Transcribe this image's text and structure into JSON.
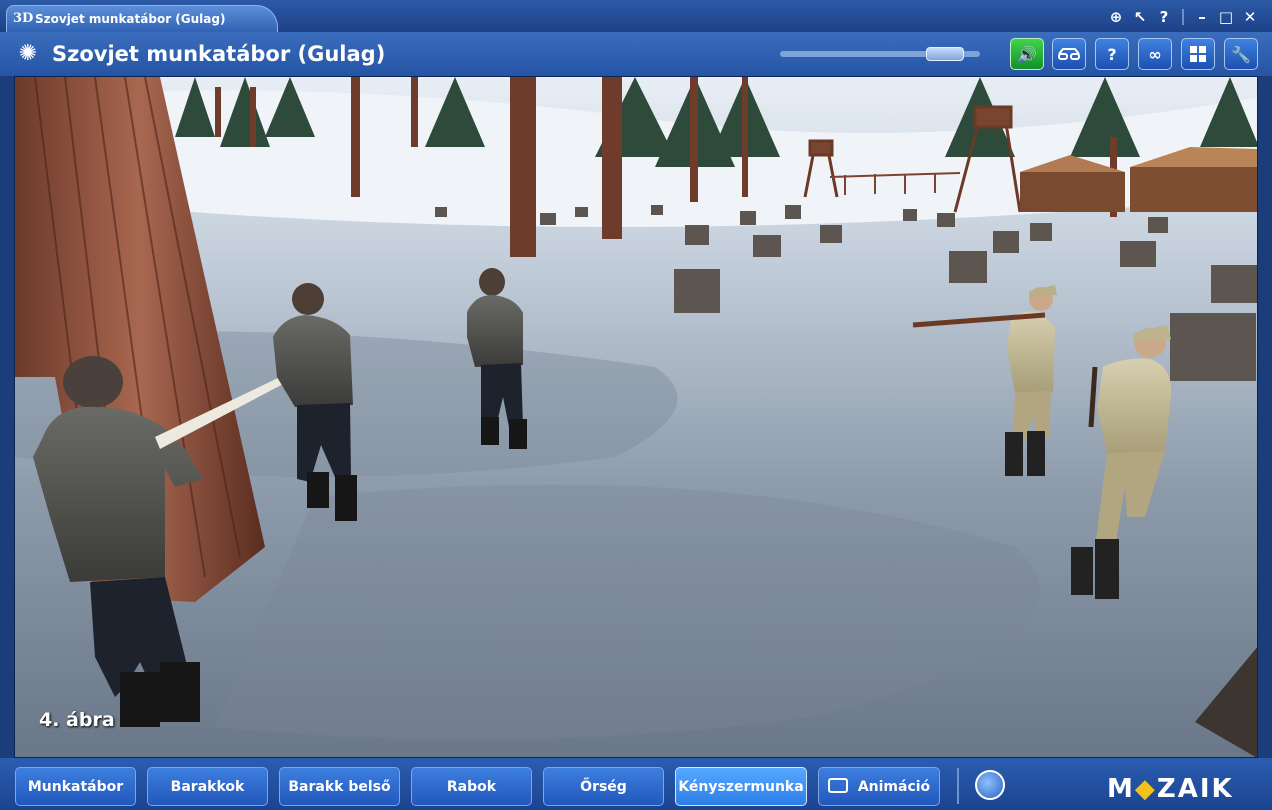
{
  "window": {
    "tab_logo": "3D",
    "tab_title": "Szovjet munkatábor (Gulag)",
    "controls": [
      "zoom-icon",
      "pointer-icon",
      "help-icon",
      "minimize-icon",
      "maximize-icon",
      "close-icon"
    ]
  },
  "header": {
    "title": "Szovjet munkatábor (Gulag)",
    "volume_level_percent": 90,
    "toolbar_icons": [
      "sound-icon",
      "glasses-icon",
      "help-icon",
      "link-icon",
      "grid-icon",
      "settings-icon"
    ]
  },
  "scene": {
    "caption": "4. ábra"
  },
  "nav": {
    "items": [
      {
        "label": "Munkatábor"
      },
      {
        "label": "Barakkok"
      },
      {
        "label": "Barakk belső"
      },
      {
        "label": "Rabok"
      },
      {
        "label": "Őrség"
      },
      {
        "label": "Kényszermunka"
      },
      {
        "label": "Animáció"
      }
    ],
    "active": "Kényszermunka"
  },
  "brand": {
    "pre": "M",
    "mark": "◆",
    "post": "ZAIK"
  },
  "colors": {
    "chrome": "#2554a5",
    "button": "#2a63c4",
    "active_button": "#3d8ef0",
    "sound_button": "#22b33a",
    "brand_accent": "#f2c31a"
  }
}
